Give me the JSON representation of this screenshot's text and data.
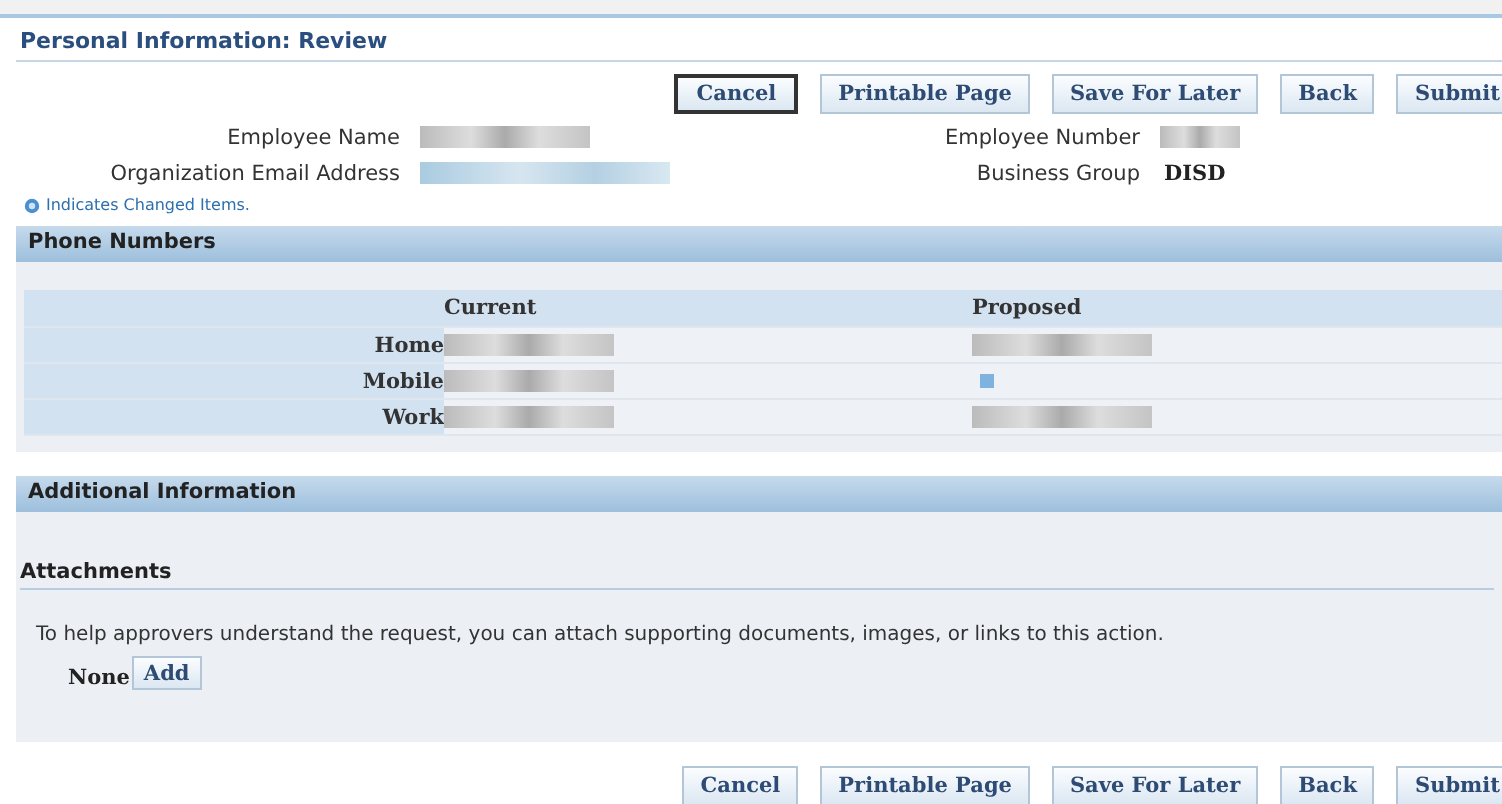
{
  "page_title": "Personal Information: Review",
  "top_buttons": [
    {
      "label": "Cancel",
      "focused": true
    },
    {
      "label": "Printable Page",
      "focused": false
    },
    {
      "label": "Save For Later",
      "focused": false
    },
    {
      "label": "Back",
      "focused": false
    },
    {
      "label": "Submit",
      "focused": false
    }
  ],
  "fields_left": [
    {
      "label": "Employee Name"
    },
    {
      "label": "Organization Email Address"
    }
  ],
  "fields_right": [
    {
      "label": "Employee Number"
    },
    {
      "label": "Business Group",
      "value": "DISD"
    }
  ],
  "changed_note": "Indicates Changed Items.",
  "phone_section": {
    "title": "Phone Numbers",
    "columns": [
      "Current",
      "Proposed"
    ],
    "rows": [
      {
        "label": "Home"
      },
      {
        "label": "Mobile"
      },
      {
        "label": "Work"
      }
    ]
  },
  "additional_section": {
    "title": "Additional Information",
    "subtitle": "Attachments",
    "text": "To help approvers understand the request, you can attach supporting documents, images, or links to this action.",
    "attachments_value": "None",
    "add_button": "Add"
  },
  "bottom_buttons": [
    {
      "label": "Cancel",
      "focused": false
    },
    {
      "label": "Printable Page",
      "focused": false
    },
    {
      "label": "Save For Later",
      "focused": false
    },
    {
      "label": "Back",
      "focused": false
    },
    {
      "label": "Submit",
      "focused": false
    }
  ]
}
